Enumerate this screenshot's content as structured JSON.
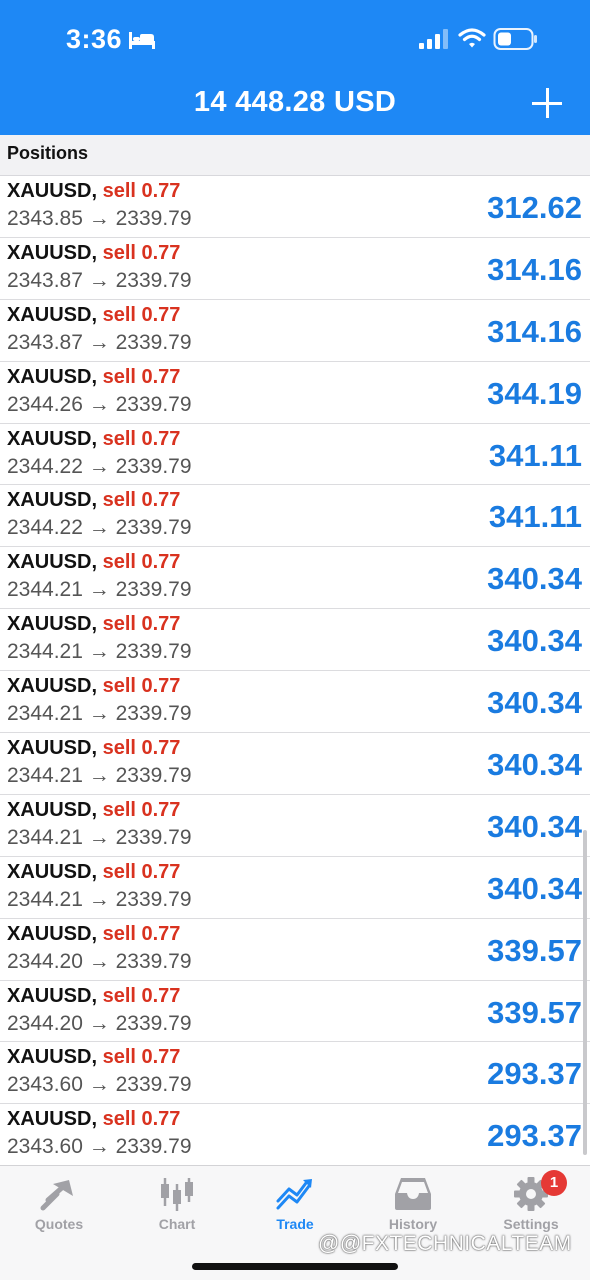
{
  "status_bar": {
    "time": "3:36"
  },
  "header": {
    "balance": "14 448.28 USD"
  },
  "section": {
    "title": "Positions"
  },
  "positions": [
    {
      "symbol": "XAUUSD,",
      "side": "sell 0.77",
      "open": "2343.85",
      "arrow": "→",
      "current": "2339.79",
      "profit": "312.62"
    },
    {
      "symbol": "XAUUSD,",
      "side": "sell 0.77",
      "open": "2343.87",
      "arrow": "→",
      "current": "2339.79",
      "profit": "314.16"
    },
    {
      "symbol": "XAUUSD,",
      "side": "sell 0.77",
      "open": "2343.87",
      "arrow": "→",
      "current": "2339.79",
      "profit": "314.16"
    },
    {
      "symbol": "XAUUSD,",
      "side": "sell 0.77",
      "open": "2344.26",
      "arrow": "→",
      "current": "2339.79",
      "profit": "344.19"
    },
    {
      "symbol": "XAUUSD,",
      "side": "sell 0.77",
      "open": "2344.22",
      "arrow": "→",
      "current": "2339.79",
      "profit": "341.11"
    },
    {
      "symbol": "XAUUSD,",
      "side": "sell 0.77",
      "open": "2344.22",
      "arrow": "→",
      "current": "2339.79",
      "profit": "341.11"
    },
    {
      "symbol": "XAUUSD,",
      "side": "sell 0.77",
      "open": "2344.21",
      "arrow": "→",
      "current": "2339.79",
      "profit": "340.34"
    },
    {
      "symbol": "XAUUSD,",
      "side": "sell 0.77",
      "open": "2344.21",
      "arrow": "→",
      "current": "2339.79",
      "profit": "340.34"
    },
    {
      "symbol": "XAUUSD,",
      "side": "sell 0.77",
      "open": "2344.21",
      "arrow": "→",
      "current": "2339.79",
      "profit": "340.34"
    },
    {
      "symbol": "XAUUSD,",
      "side": "sell 0.77",
      "open": "2344.21",
      "arrow": "→",
      "current": "2339.79",
      "profit": "340.34"
    },
    {
      "symbol": "XAUUSD,",
      "side": "sell 0.77",
      "open": "2344.21",
      "arrow": "→",
      "current": "2339.79",
      "profit": "340.34"
    },
    {
      "symbol": "XAUUSD,",
      "side": "sell 0.77",
      "open": "2344.21",
      "arrow": "→",
      "current": "2339.79",
      "profit": "340.34"
    },
    {
      "symbol": "XAUUSD,",
      "side": "sell 0.77",
      "open": "2344.20",
      "arrow": "→",
      "current": "2339.79",
      "profit": "339.57"
    },
    {
      "symbol": "XAUUSD,",
      "side": "sell 0.77",
      "open": "2344.20",
      "arrow": "→",
      "current": "2339.79",
      "profit": "339.57"
    },
    {
      "symbol": "XAUUSD,",
      "side": "sell 0.77",
      "open": "2343.60",
      "arrow": "→",
      "current": "2339.79",
      "profit": "293.37"
    },
    {
      "symbol": "XAUUSD,",
      "side": "sell 0.77",
      "open": "2343.60",
      "arrow": "→",
      "current": "2339.79",
      "profit": "293.37"
    }
  ],
  "tabs": [
    {
      "label": "Quotes",
      "icon": "quotes-icon",
      "active": false
    },
    {
      "label": "Chart",
      "icon": "candlestick-chart-icon",
      "active": false
    },
    {
      "label": "Trade",
      "icon": "trade-icon",
      "active": true
    },
    {
      "label": "History",
      "icon": "inbox-history-icon",
      "active": false
    },
    {
      "label": "Settings",
      "icon": "gear-icon",
      "active": false,
      "badge": "1"
    }
  ],
  "watermark": "@@FXTECHNICALTEAM",
  "colors": {
    "accent": "#1e88f5",
    "sell": "#d9321f",
    "profit": "#1a7be0",
    "inactive_tab": "#a1a1a6",
    "badge": "#e53935"
  }
}
